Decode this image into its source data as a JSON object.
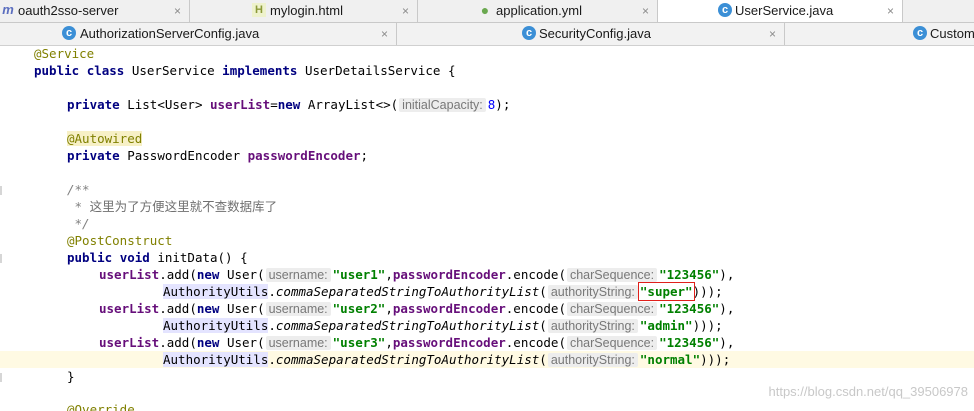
{
  "tabs_row1": [
    {
      "label": "oauth2sso-server",
      "icon": "m",
      "icon_name": "maven-module-icon",
      "icon_color": "#5b6ebf",
      "active": false
    },
    {
      "label": "mylogin.html",
      "icon": "H",
      "icon_name": "html-file-icon",
      "icon_color": "#8c9a3a",
      "active": false
    },
    {
      "label": "application.yml",
      "icon": "●",
      "icon_name": "spring-config-icon",
      "icon_color": "#6aa84f",
      "active": false
    },
    {
      "label": "UserService.java",
      "icon": "c",
      "icon_name": "java-class-icon",
      "icon_color": "#3b8fd6",
      "active": true
    }
  ],
  "tabs_row2": [
    {
      "label": "AuthorizationServerConfig.java",
      "icon": "c",
      "icon_name": "java-class-icon",
      "icon_color": "#3b8fd6"
    },
    {
      "label": "SecurityConfig.java",
      "icon": "c",
      "icon_name": "java-class-icon",
      "icon_color": "#3b8fd6"
    },
    {
      "label": "Custom",
      "icon": "c",
      "icon_name": "java-class-icon",
      "icon_color": "#3b8fd6"
    }
  ],
  "close_glyph": "×",
  "code": {
    "service_anno": "@Service",
    "kw_public": "public",
    "kw_class": "class",
    "class_name": " UserService ",
    "kw_implements": "implements",
    "iface": " UserDetailsService {",
    "kw_private": "private",
    "list_type": " List<User> ",
    "user_list_field": "userList",
    "eq": "=",
    "kw_new": "new",
    "array_list": " ArrayList<>(",
    "hint_initial_capacity": "initialCapacity:",
    "num_8": "8",
    "close_paren_semi": ");",
    "autowired": "@Autowired",
    "encoder_type": " PasswordEncoder ",
    "encoder_field": "passwordEncoder",
    "semi": ";",
    "comment_open": "/**",
    "comment_star": " * ",
    "comment_text": "这里为了方便这里就不查数据库了",
    "comment_close": " */",
    "post_construct": "@PostConstruct",
    "kw_void": "void",
    "init_sig": " initData() {",
    "add_call": ".add(",
    "user_ctor": " User(",
    "hint_username": "username:",
    "user1": "\"user1\"",
    "user2": "\"user2\"",
    "user3": "\"user3\"",
    "comma": ",",
    "encode_call": ".encode(",
    "hint_char_sequence": "charSequence:",
    "pwd": "\"123456\"",
    "close_paren_comma": "),",
    "authority_utils": "AuthorityUtils",
    "dot": ".",
    "csv_method": "commaSeparatedStringToAuthorityList",
    "open_paren": "(",
    "hint_authority_string": "authorityString:",
    "super": "\"super\"",
    "admin": "\"admin\"",
    "normal": "\"normal\"",
    "close_parens_end": ")));",
    "close_paren": ")",
    "close_parens_end2": "));",
    "close_brace": "}",
    "override": "@Override"
  },
  "watermark": "https://blog.csdn.net/qq_39506978"
}
